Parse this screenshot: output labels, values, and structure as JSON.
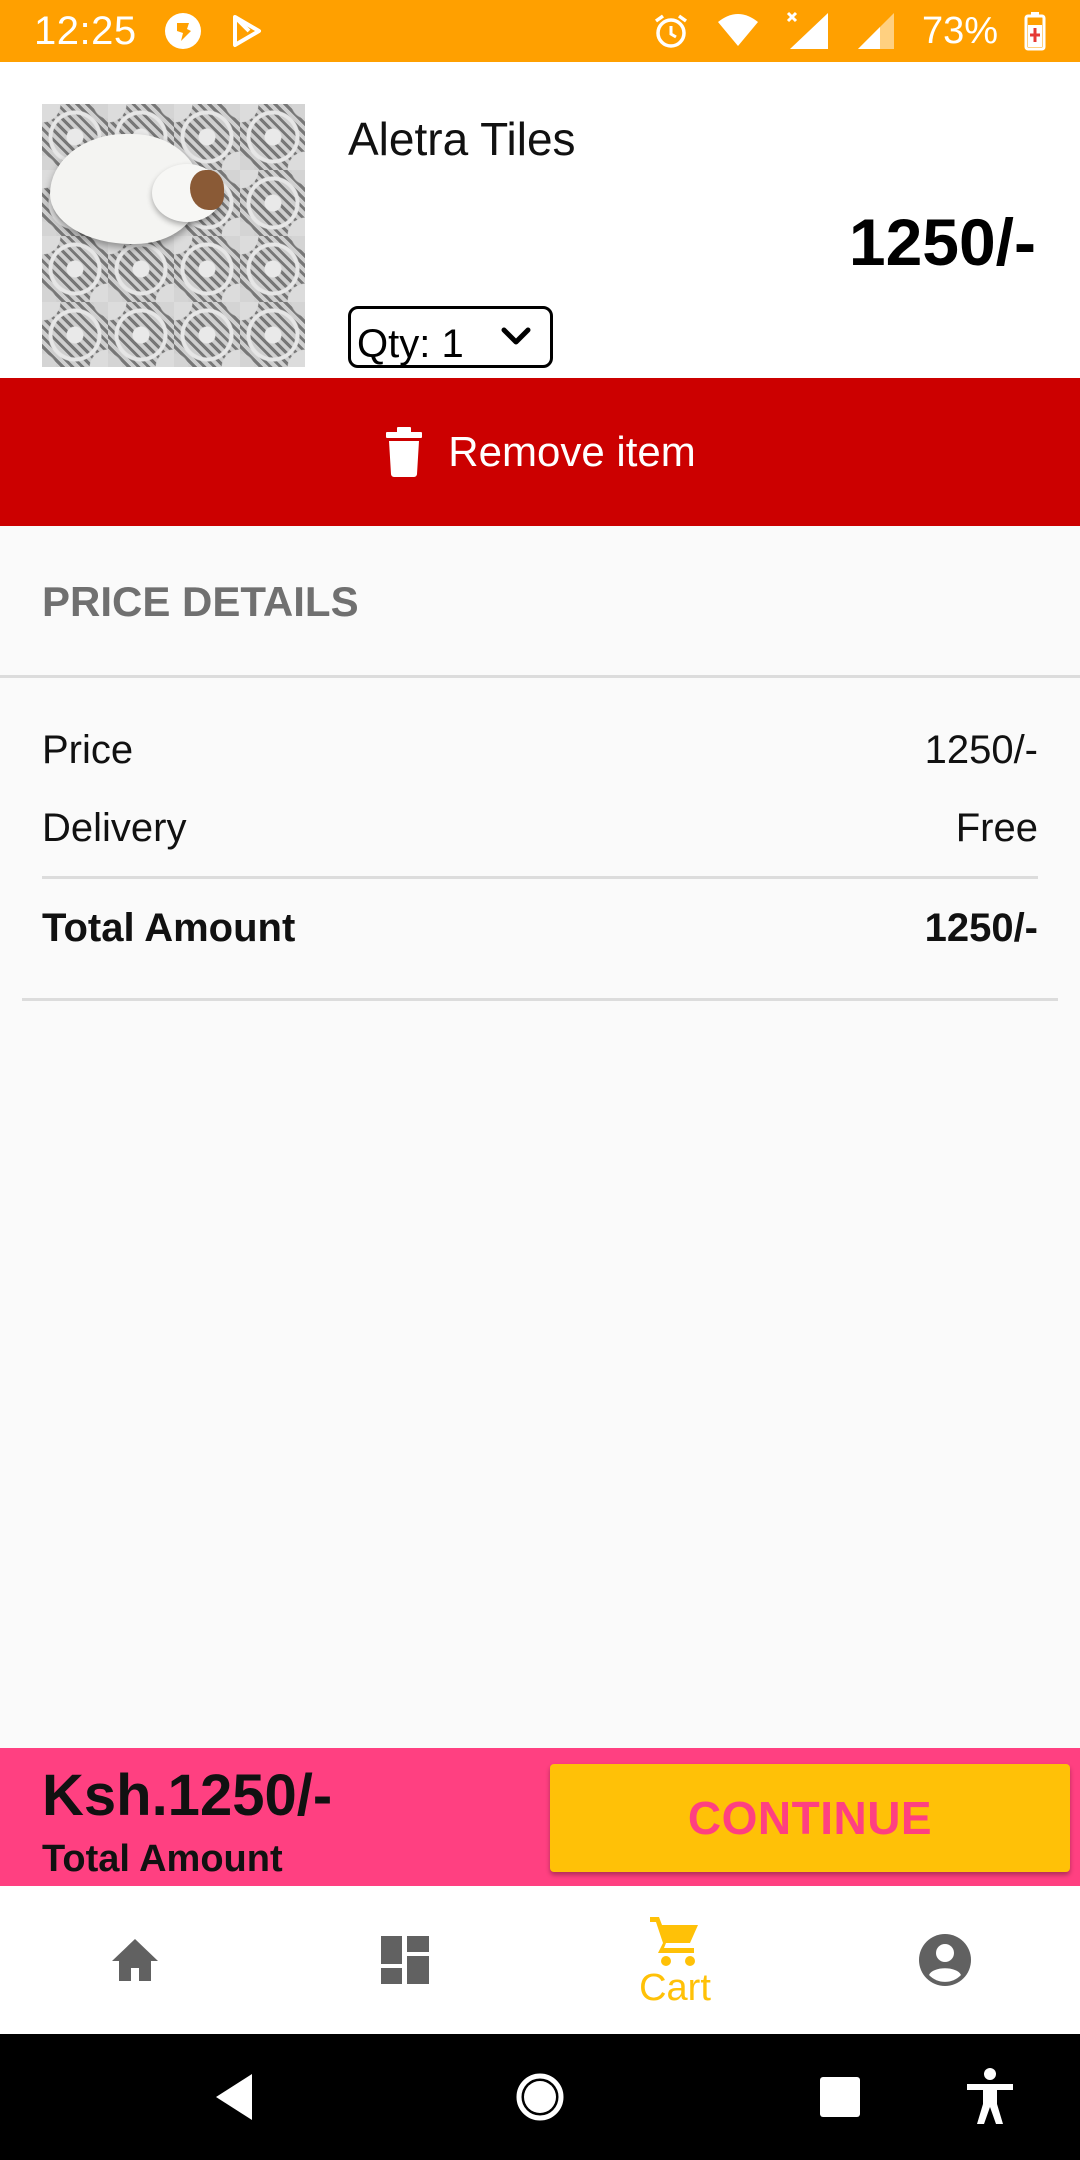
{
  "status_bar": {
    "time": "12:25",
    "battery": "73%",
    "icons": [
      "app-notification-icon",
      "play-store-icon",
      "alarm-icon",
      "wifi-icon",
      "signal-icon",
      "battery-charging-icon"
    ]
  },
  "cart_item": {
    "title": "Aletra Tiles",
    "price": "1250/-",
    "quantity_label": "Qty: 1",
    "remove_label": "Remove item"
  },
  "price_details": {
    "header": "PRICE DETAILS",
    "rows": [
      {
        "label": "Price",
        "value": "1250/-"
      },
      {
        "label": "Delivery",
        "value": "Free"
      }
    ],
    "total_label": "Total Amount",
    "total_value": "1250/-"
  },
  "checkout": {
    "amount": "Ksh.1250/-",
    "caption": "Total Amount",
    "button_label": "CONTINUE"
  },
  "bottom_nav": {
    "items": [
      {
        "icon": "home-icon",
        "label": ""
      },
      {
        "icon": "dashboard-icon",
        "label": ""
      },
      {
        "icon": "cart-icon",
        "label": "Cart",
        "active": true
      },
      {
        "icon": "account-icon",
        "label": ""
      }
    ]
  },
  "colors": {
    "status_bar": "#ffa000",
    "remove_bar": "#cc0000",
    "checkout_bar": "#ff4081",
    "continue_button": "#ffc107",
    "active_nav": "#ffc107",
    "inactive_nav": "#616161"
  }
}
